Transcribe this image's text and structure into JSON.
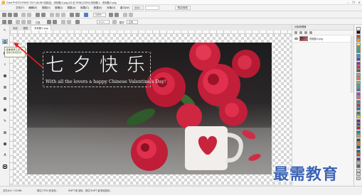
{
  "window": {
    "title": "Corel PHOTO-PAINT 2017 (64-Bit 待激活) - 未标题-2.png (24-位 RGB) [100%] 未标题-1 - 未标题-2.png",
    "controls": [
      "–",
      "❐",
      "✕"
    ]
  },
  "menubar": {
    "items": [
      "文件(F)",
      "编辑(E)",
      "视图(V)",
      "图像(I)",
      "调整(A)",
      "效果(C)",
      "遮罩(K)",
      "对象(O)",
      "窗口(W)",
      "帮助(H)"
    ],
    "launcher_label": "启动(L)",
    "right_button": "购买/使用"
  },
  "toolbar": {
    "zoom_value": "100%"
  },
  "propbar": {
    "label_a": "已选",
    "field_a": "0 mm",
    "label_b": "模式",
    "field_b": "正常"
  },
  "tabs": [
    "欢迎",
    "图层",
    "未标题-2.png"
  ],
  "canvas": {
    "headline": "七夕快乐",
    "subline": "With all the lovers a happy Chinese Valentine's Day!"
  },
  "tooltip": {
    "title": "选择/套索工具 (0)",
    "desc": "选择对象或区域"
  },
  "panel": {
    "header": "对象管理器",
    "layer_label": "背景图-2.png"
  },
  "status": {
    "file_size": "文件大小: 7.03 MB",
    "hint_ctrl": "按住 CTRL 和 鼠标...",
    "hint_shift": "SHIFT 和 鼠标... 按住 SHIFT 键 拖动鼠标..."
  },
  "watermark": "最需教育",
  "colors": {
    "palette": [
      "#ffffff",
      "#000000",
      "#e53935",
      "#f4a100",
      "#ffeb3b",
      "#4caf50",
      "#26a69a",
      "#2196f3",
      "#3f51b5",
      "#9c27b0",
      "#e91e63",
      "#795548",
      "#9e9e9e",
      "#ff7043",
      "#8bc34a",
      "#00bcd4",
      "#5c6bc0",
      "#ab47bc",
      "#f06292",
      "#607d8b",
      "#d32f2f",
      "#1976d2",
      "#388e3c",
      "#fbc02d",
      "#7b1fa2",
      "#455a64",
      "#c2185b",
      "#0097a7",
      "#afb42b",
      "#5d4037",
      "#f57c00",
      "#303f9f",
      "#00796b",
      "#e64a19",
      "#512da8",
      "#bdbdbd",
      "#616161",
      "#ffccbc",
      "#b2dfdb",
      "#c5cae9"
    ],
    "accent": "#3b63b4"
  }
}
